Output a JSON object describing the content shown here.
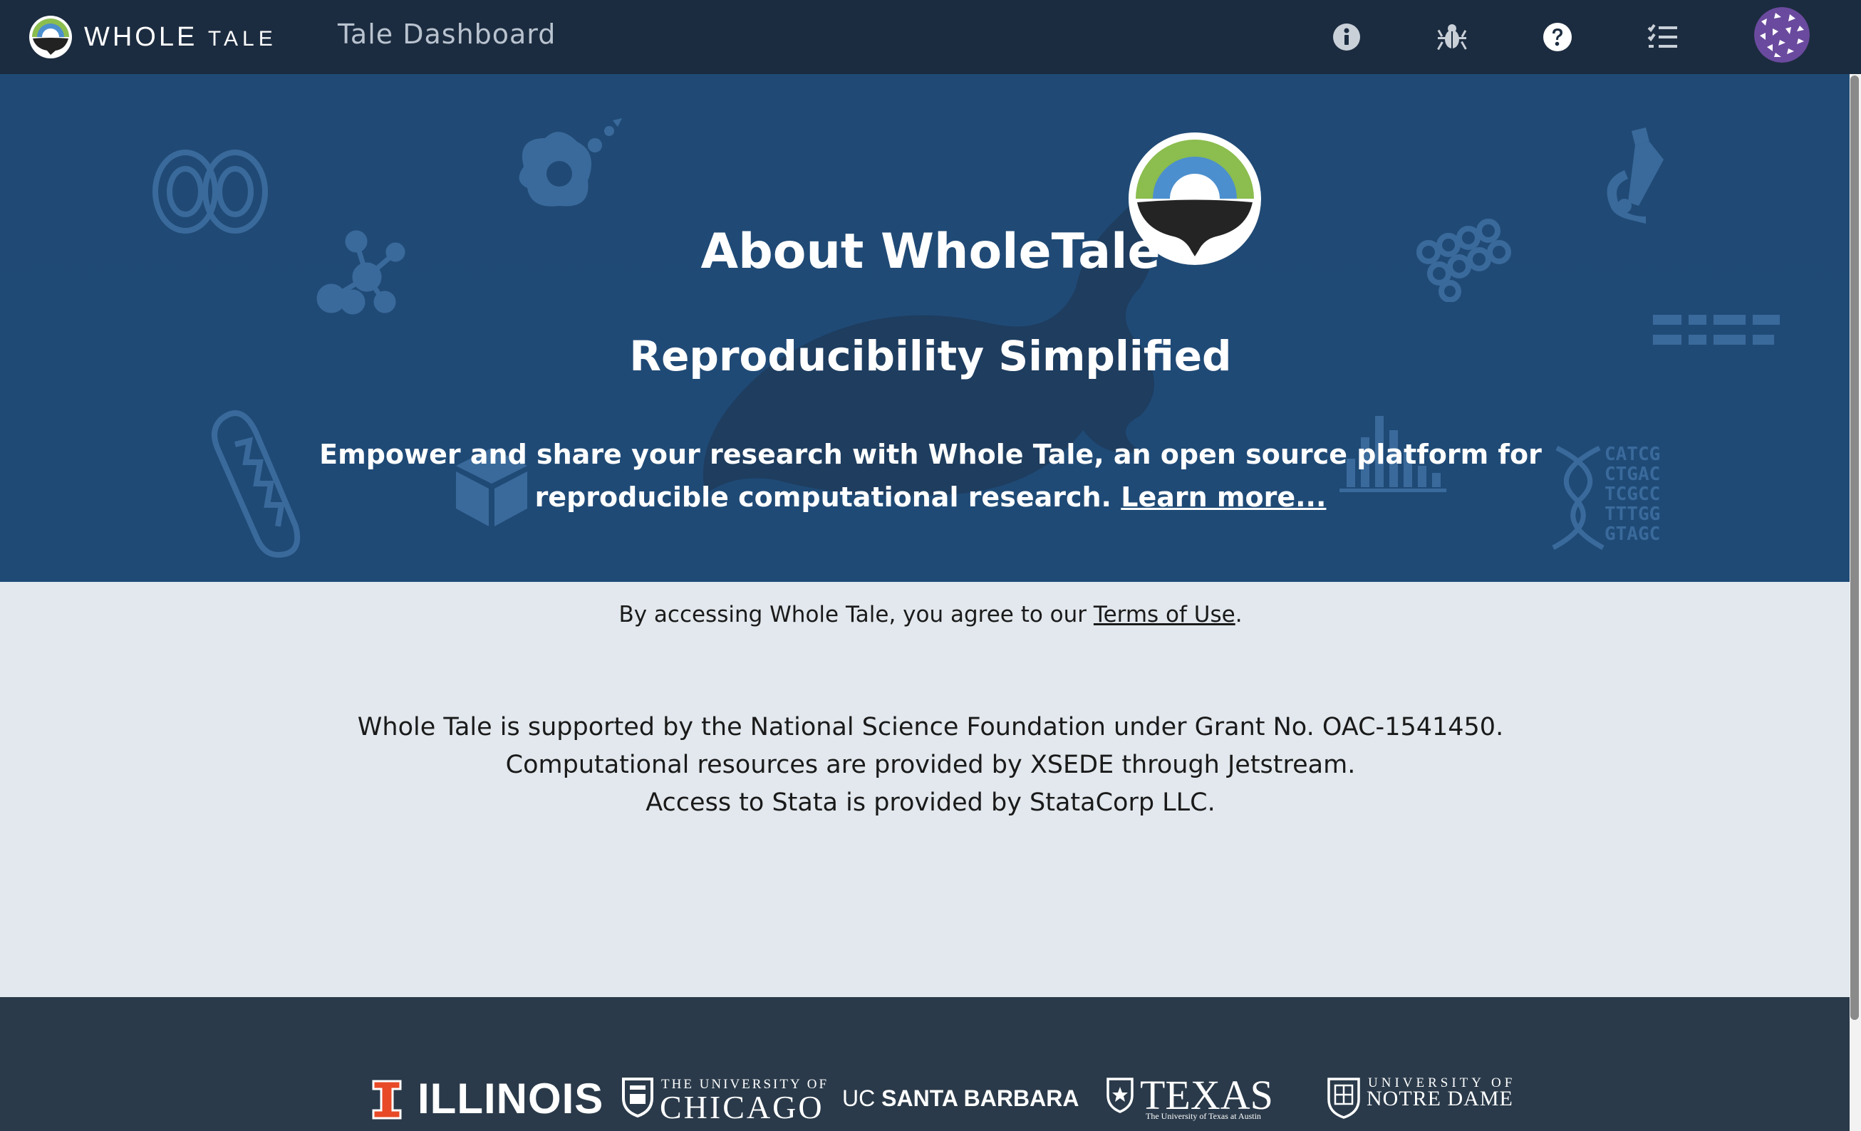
{
  "nav": {
    "brand_whole": "WHOLE",
    "brand_tale": "TALE",
    "title": "Tale Dashboard",
    "icons": [
      "info-icon",
      "bug-icon",
      "help-icon",
      "task-list-icon",
      "user-avatar"
    ]
  },
  "hero": {
    "title": "About WholeTale",
    "subtitle": "Reproducibility Simplified",
    "description_line1": "Empower and share your research with Whole Tale, an open source platform for",
    "description_line2": "reproducible computational research.",
    "learn_more": "Learn more..."
  },
  "terms": {
    "prefix": "By accessing Whole Tale, you agree to our",
    "link": "Terms of Use",
    "suffix": "."
  },
  "support": {
    "line1": "Whole Tale is supported by the National Science Foundation under Grant No. OAC-1541450.",
    "line2": "Computational resources are provided by XSEDE through Jetstream.",
    "line3": "Access to Stata is provided by StataCorp LLC."
  },
  "footer": {
    "illinois": "ILLINOIS",
    "chicago_top": "THE UNIVERSITY OF",
    "chicago_main": "CHICAGO",
    "ucsb_uc": "UC",
    "ucsb_main": "SANTA BARBARA",
    "texas_main": "TEXAS",
    "texas_sub": "The University of Texas at Austin",
    "nd_top": "UNIVERSITY OF",
    "nd_main": "NOTRE DAME"
  },
  "deco_dna": [
    "CATCG",
    "CTGAC",
    "TCGCC",
    "TTTGG",
    "GTAGC"
  ],
  "colors": {
    "nav_bg": "#1c2c40",
    "hero_bg": "#204a75",
    "info_bg": "#e2e8ed",
    "footer_bg": "#2a3a4a",
    "logo_green": "#8bbd4f",
    "logo_blue": "#4c8fce",
    "illinois_orange": "#e84a27"
  }
}
